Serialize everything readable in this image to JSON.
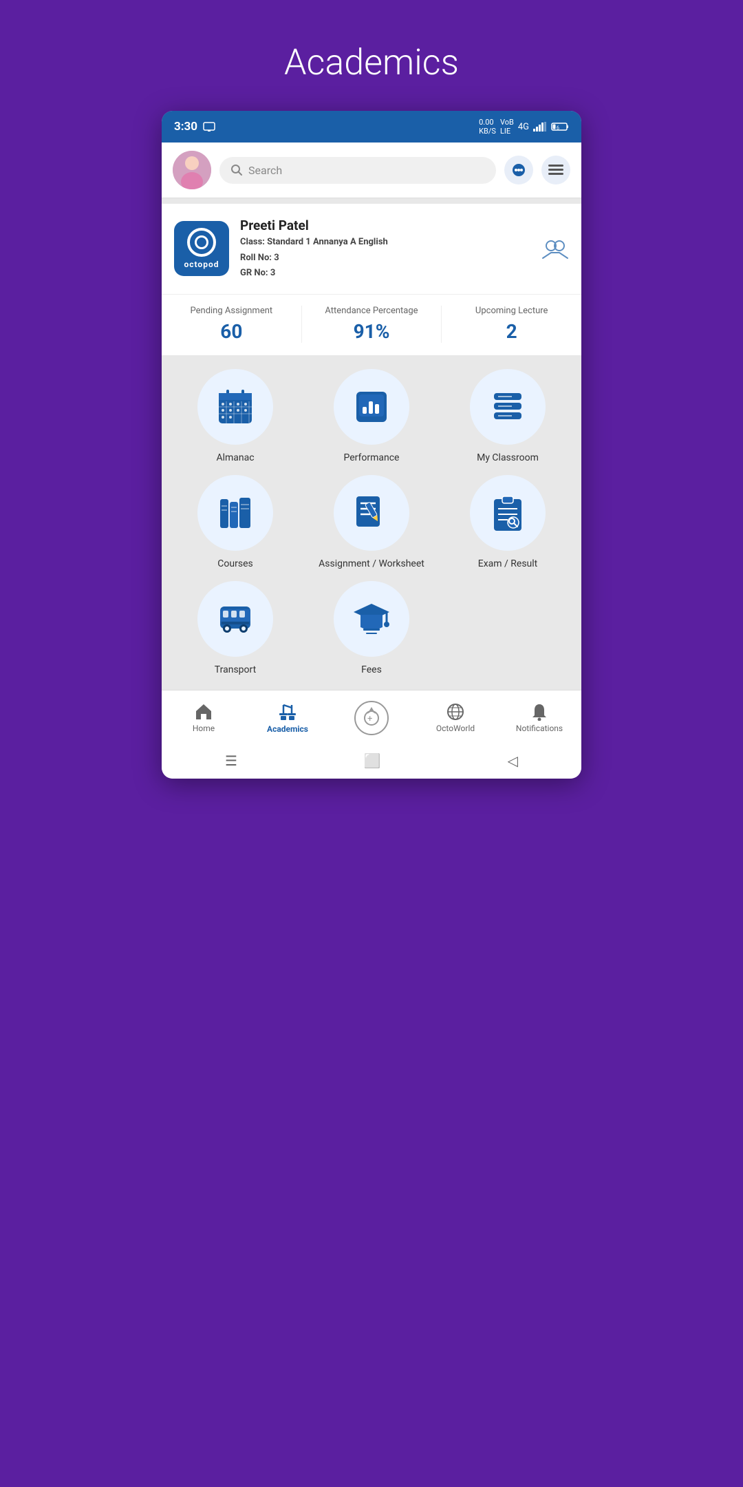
{
  "page": {
    "title": "Academics",
    "bg_color": "#5b1fa0"
  },
  "status_bar": {
    "time": "3:30",
    "network": "4G",
    "battery": "6"
  },
  "search": {
    "placeholder": "Search",
    "icon": "search-icon"
  },
  "profile": {
    "name": "Preeti Patel",
    "class_label": "Class:",
    "class_value": "Standard 1 Annanya A English",
    "roll_label": "Roll No:",
    "roll_value": "3",
    "gr_label": "GR No:",
    "gr_value": "3"
  },
  "stats": [
    {
      "label": "Pending Assignment",
      "value": "60"
    },
    {
      "label": "Attendance Percentage",
      "value": "91%"
    },
    {
      "label": "Upcoming Lecture",
      "value": "2"
    }
  ],
  "grid_items": [
    {
      "id": "almanac",
      "label": "Almanac"
    },
    {
      "id": "performance",
      "label": "Performance"
    },
    {
      "id": "my-classroom",
      "label": "My Classroom"
    },
    {
      "id": "courses",
      "label": "Courses"
    },
    {
      "id": "assignment-worksheet",
      "label": "Assignment / Worksheet"
    },
    {
      "id": "exam-result",
      "label": "Exam / Result"
    },
    {
      "id": "transport",
      "label": "Transport"
    },
    {
      "id": "fees",
      "label": "Fees"
    }
  ],
  "bottom_nav": [
    {
      "id": "home",
      "label": "Home",
      "active": false
    },
    {
      "id": "academics",
      "label": "Academics",
      "active": true
    },
    {
      "id": "octoworld-center",
      "label": "",
      "active": false
    },
    {
      "id": "octoworld",
      "label": "OctoWorld",
      "active": false
    },
    {
      "id": "notifications",
      "label": "Notifications",
      "active": false
    }
  ]
}
